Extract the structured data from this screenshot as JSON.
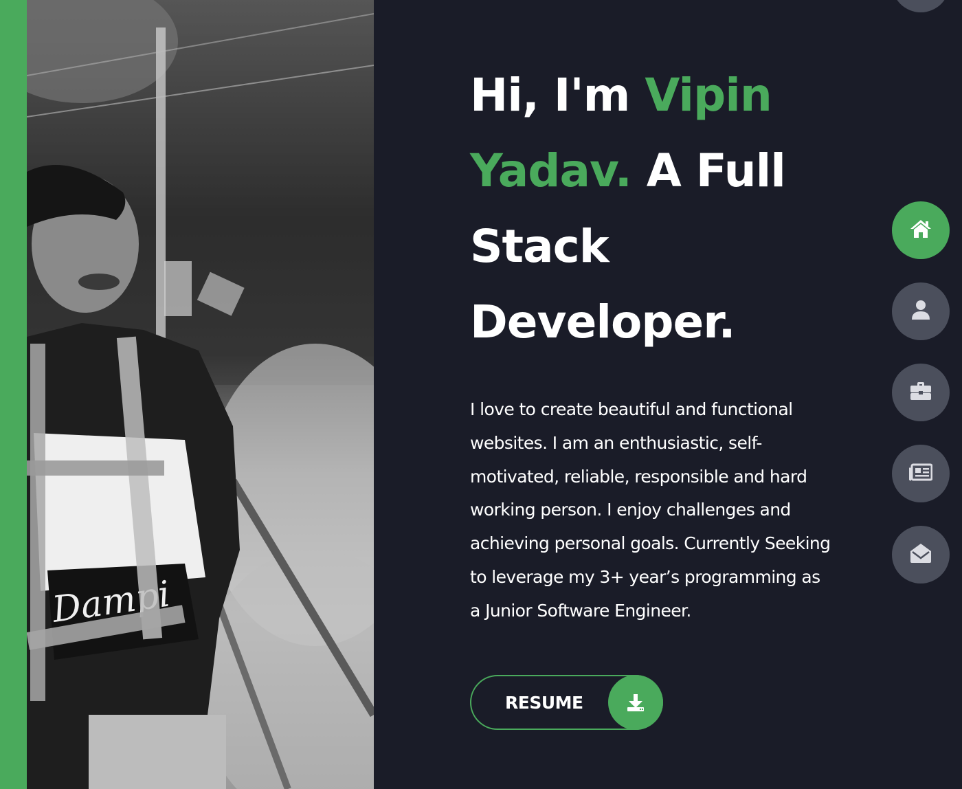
{
  "hero": {
    "greeting_pre": "Hi, I'm ",
    "name": "Vipin Yadav.",
    "greeting_post": " A Full Stack Developer.",
    "bio": "I love to create beautiful and functional websites. I am an enthusiastic, self-motivated, reliable, responsible and hard working person. I enjoy challenges and achieving personal goals. Currently Seeking to leverage my 3+ year’s programming as a Junior Software Engineer."
  },
  "resume_button": {
    "label": "RESUME",
    "icon": "download-icon"
  },
  "nav": {
    "items": [
      {
        "icon": "home-icon",
        "active": true
      },
      {
        "icon": "user-icon",
        "active": false
      },
      {
        "icon": "briefcase-icon",
        "active": false
      },
      {
        "icon": "newspaper-icon",
        "active": false
      },
      {
        "icon": "envelope-open-icon",
        "active": false
      }
    ]
  },
  "colors": {
    "accent": "#4aaa5c",
    "background": "#1a1c28",
    "nav_inactive": "#4b4f5c",
    "text": "#ffffff"
  }
}
